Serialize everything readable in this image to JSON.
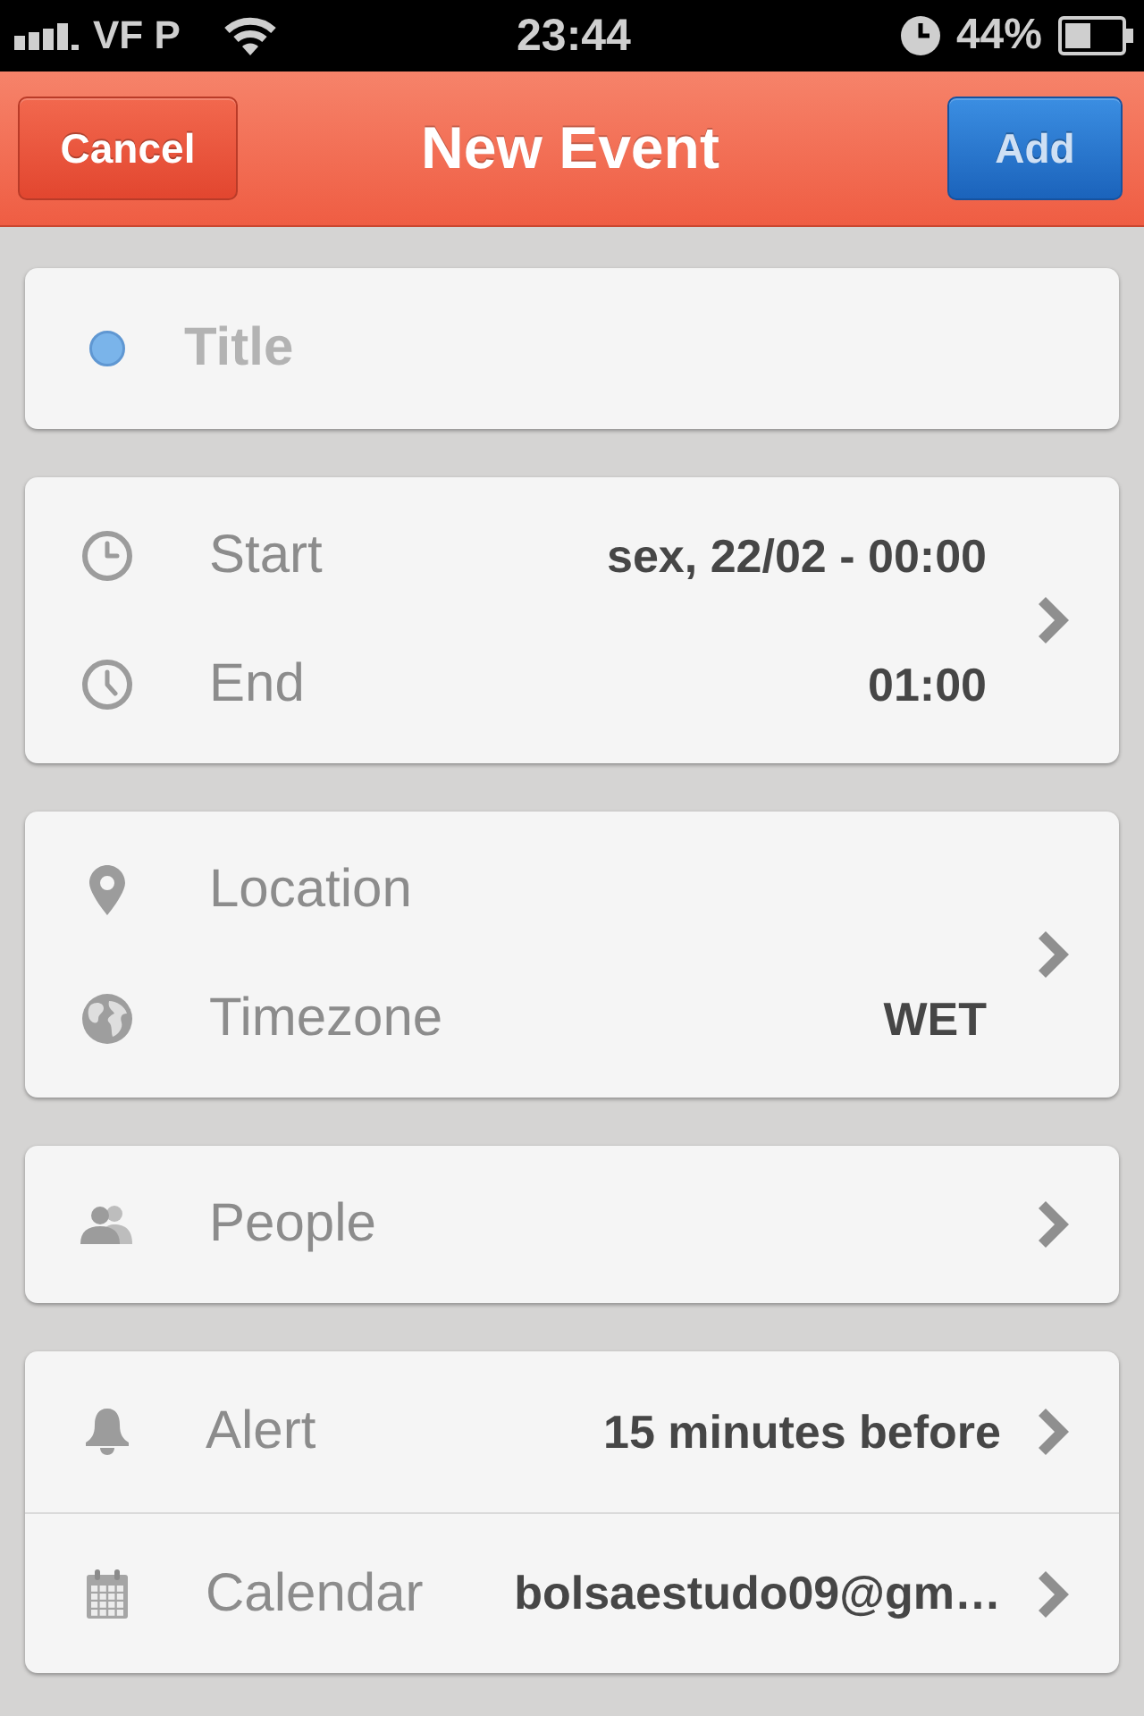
{
  "status_bar": {
    "carrier": "VF P",
    "time": "23:44",
    "battery": "44%"
  },
  "nav_bar": {
    "cancel_button": "Cancel",
    "title": "New Event",
    "add_button": "Add"
  },
  "title_field": {
    "placeholder": "Title"
  },
  "groups": [
    {
      "kind": "joined",
      "rows": [
        {
          "kind": "start",
          "label": "Start",
          "value": "sex, 22/02 - 00:00"
        },
        {
          "kind": "end",
          "label": "End",
          "value": "01:00"
        }
      ]
    },
    {
      "kind": "joined",
      "rows": [
        {
          "kind": "location",
          "label": "Location"
        },
        {
          "kind": "timezone",
          "label": "Timezone",
          "value": "WET"
        }
      ]
    },
    {
      "kind": "joined",
      "rows": [
        {
          "kind": "people",
          "label": "People"
        }
      ]
    },
    {
      "kind": "split",
      "rows": [
        {
          "kind": "alert",
          "label": "Alert",
          "value": "15 minutes before"
        },
        {
          "kind": "calendar",
          "label": "Calendar",
          "value": "bolsaestudo09@gm…"
        }
      ]
    }
  ]
}
